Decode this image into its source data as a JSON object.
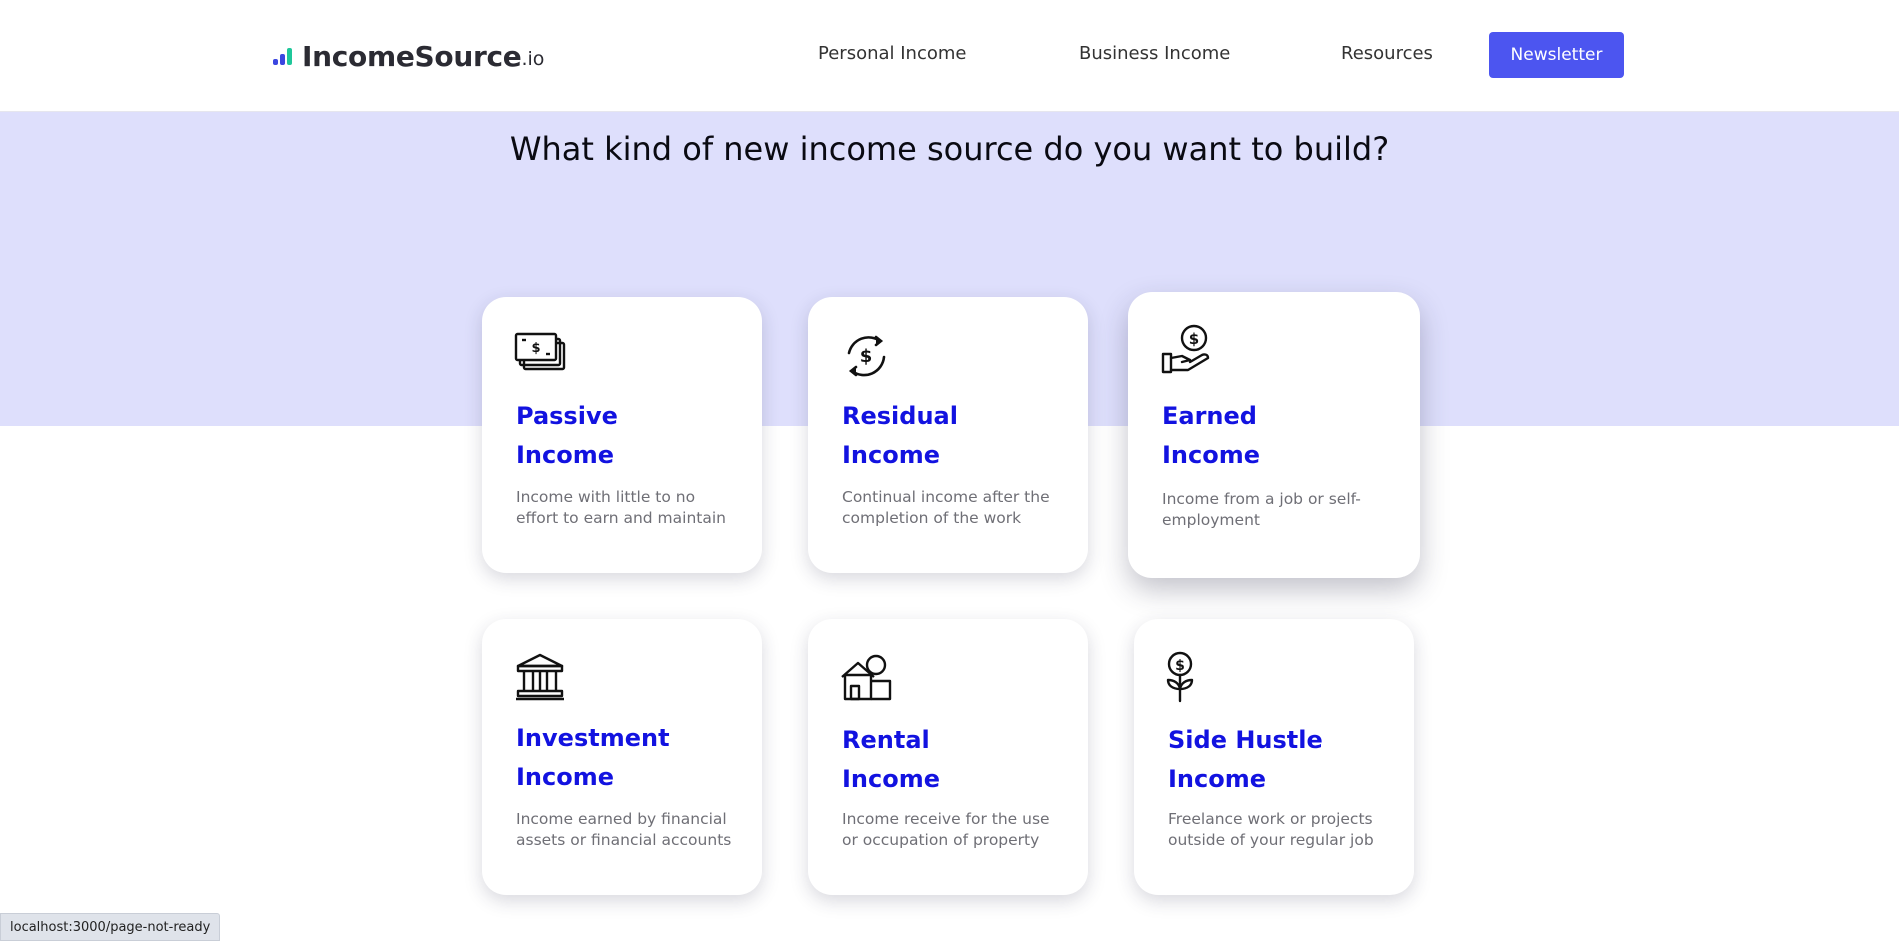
{
  "header": {
    "logo_text": "IncomeSource",
    "logo_tld": ".io",
    "nav": [
      "Personal Income",
      "Business Income",
      "Resources"
    ],
    "newsletter_label": "Newsletter",
    "accent_color": "#4c55f0"
  },
  "hero": {
    "headline": "What kind of new income source do you want to build?",
    "background_color": "#dedffc"
  },
  "cards": [
    {
      "icon": "cash-stack-icon",
      "title_line1": "Passive",
      "title_line2": "Income",
      "description": "Income with little to no effort to earn and maintain"
    },
    {
      "icon": "dollar-cycle-icon",
      "title_line1": "Residual",
      "title_line2": "Income",
      "description": "Continual income after the completion of the work"
    },
    {
      "icon": "hand-coin-icon",
      "title_line1": "Earned",
      "title_line2": "Income",
      "description": "Income from a job or self-employment"
    },
    {
      "icon": "bank-icon",
      "title_line1": "Investment",
      "title_line2": "Income",
      "description": "Income earned by financial assets or financial accounts"
    },
    {
      "icon": "house-coin-icon",
      "title_line1": "Rental",
      "title_line2": "Income",
      "description": "Income receive for the use or occupation of property"
    },
    {
      "icon": "money-plant-icon",
      "title_line1": "Side Hustle",
      "title_line2": "Income",
      "description": "Freelance work or projects outside of your regular job"
    }
  ],
  "status_bar": {
    "url": "localhost:3000/page-not-ready"
  }
}
